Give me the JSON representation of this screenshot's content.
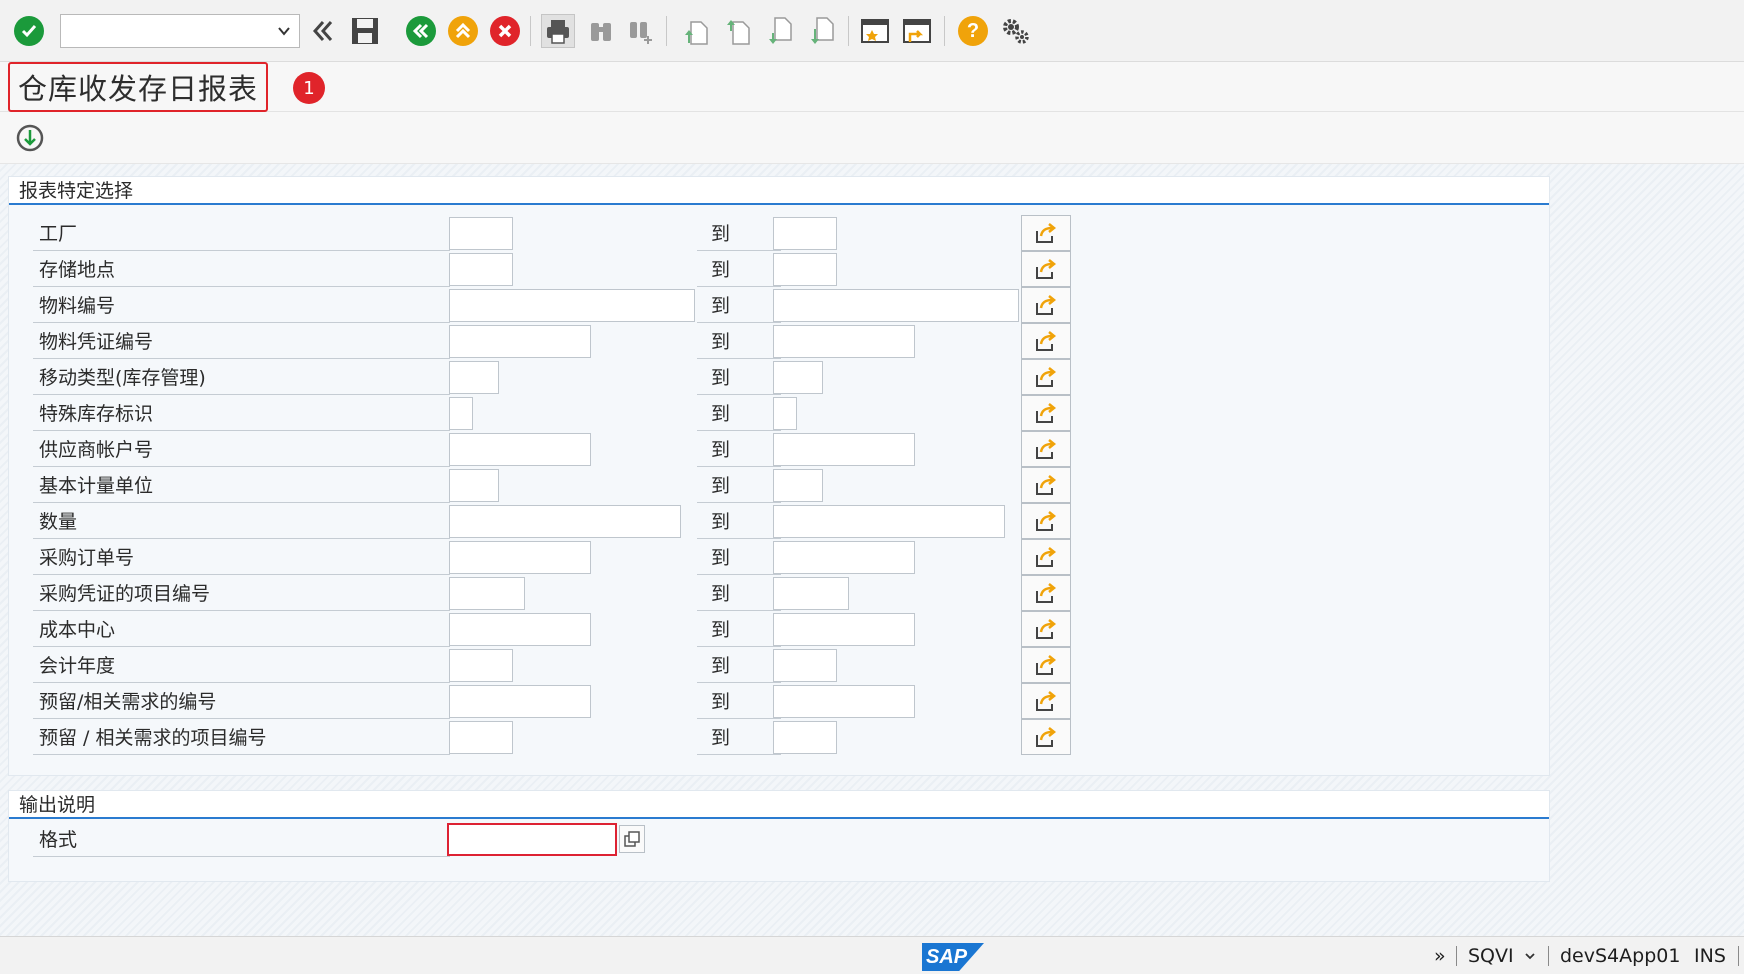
{
  "toolbar": {
    "command_field_value": "",
    "icons": [
      "check-icon",
      "double-chevron-left-icon",
      "save-icon",
      "back-icon",
      "exit-icon",
      "cancel-icon",
      "print-icon",
      "find-icon",
      "find-next-icon",
      "first-page-icon",
      "previous-page-icon",
      "next-page-icon",
      "last-page-icon",
      "new-session-icon",
      "shortcut-icon",
      "help-icon",
      "settings-icon"
    ]
  },
  "title": {
    "text": "仓库收发存日报表",
    "badge": "1"
  },
  "selection": {
    "heading": "报表特定选择",
    "to_label": "到",
    "rows": [
      {
        "label": "工厂",
        "from": "",
        "to": ""
      },
      {
        "label": "存储地点",
        "from": "",
        "to": ""
      },
      {
        "label": "物料编号",
        "from": "",
        "to": ""
      },
      {
        "label": "物料凭证编号",
        "from": "",
        "to": ""
      },
      {
        "label": "移动类型(库存管理)",
        "from": "",
        "to": ""
      },
      {
        "label": "特殊库存标识",
        "from": "",
        "to": ""
      },
      {
        "label": "供应商帐户号",
        "from": "",
        "to": ""
      },
      {
        "label": "基本计量单位",
        "from": "",
        "to": ""
      },
      {
        "label": "数量",
        "from": "",
        "to": ""
      },
      {
        "label": "采购订单号",
        "from": "",
        "to": ""
      },
      {
        "label": "采购凭证的项目编号",
        "from": "",
        "to": ""
      },
      {
        "label": "成本中心",
        "from": "",
        "to": ""
      },
      {
        "label": "会计年度",
        "from": "",
        "to": ""
      },
      {
        "label": "预留/相关需求的编号",
        "from": "",
        "to": ""
      },
      {
        "label": "预留 / 相关需求的项目编号",
        "from": "",
        "to": ""
      }
    ]
  },
  "output": {
    "heading": "输出说明",
    "format_label": "格式",
    "format_value": ""
  },
  "statusbar": {
    "sap_logo": "SAP",
    "arrows": "»",
    "transaction": "SQVI",
    "server": "devS4App01",
    "mode": "INS"
  },
  "colors": {
    "accent_blue": "#2a7bd0",
    "highlight_red": "#e0242a",
    "confirm_green": "#1b9a3b",
    "exit_orange": "#f0a30a"
  }
}
